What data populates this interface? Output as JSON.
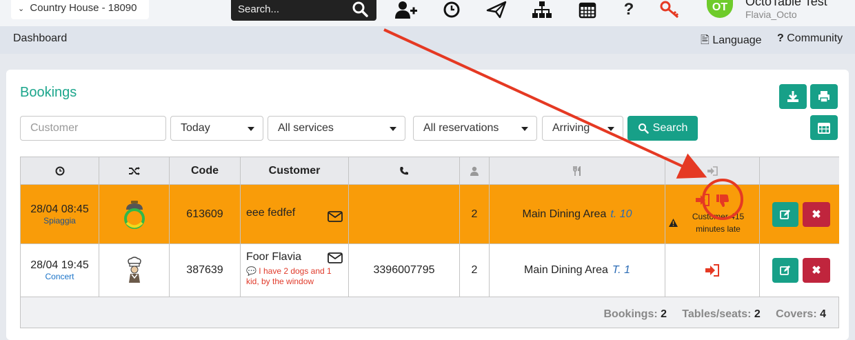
{
  "topbar": {
    "venue": "Country House - 18090",
    "search_placeholder": "Search...",
    "icons": [
      "add-user-icon",
      "clock-icon",
      "paper-plane-icon",
      "sitemap-icon",
      "calendar-icon",
      "question-icon",
      "key-icon"
    ],
    "avatar_initials": "OT",
    "user_name": "OctoTable Test",
    "user_login": "Flavia_Octo"
  },
  "subbar": {
    "dashboard": "Dashboard",
    "language": "Language",
    "community": "Community"
  },
  "bookings": {
    "title": "Bookings",
    "filters": {
      "customer_placeholder": "Customer",
      "date": "Today",
      "services": "All services",
      "reservations": "All reservations",
      "status": "Arriving",
      "search_label": "Search"
    },
    "columns": [
      "Code",
      "Customer"
    ],
    "rows": [
      {
        "datetime": "28/04 08:45",
        "service": "Spiaggia",
        "code": "613609",
        "customer": "eee fedfef",
        "note": "",
        "phone": "",
        "covers": "2",
        "area": "Main Dining Area",
        "table": "t. 10",
        "status_text": "Customer 415 minutes late"
      },
      {
        "datetime": "28/04 19:45",
        "service": "Concert",
        "code": "387639",
        "customer": "Foor Flavia",
        "note": "I have 2 dogs and 1 kid, by the window",
        "phone": "3396007795",
        "covers": "2",
        "area": "Main Dining Area",
        "table": "T. 1",
        "status_text": ""
      }
    ],
    "footer": {
      "bookings_label": "Bookings:",
      "bookings_value": "2",
      "tables_label": "Tables/seats:",
      "tables_value": "2",
      "covers_label": "Covers:",
      "covers_value": "4"
    }
  },
  "colors": {
    "accent": "#17a088",
    "late_row": "#f99c09",
    "danger": "#c0253d",
    "annotation": "#e53923"
  }
}
